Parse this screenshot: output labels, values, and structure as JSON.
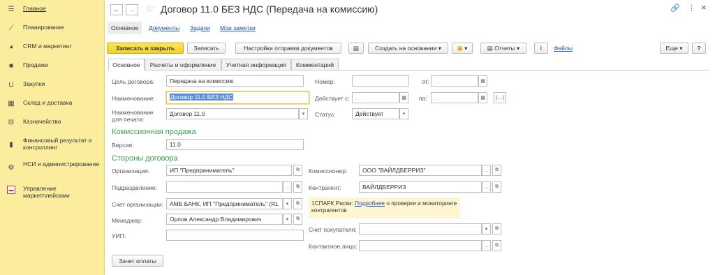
{
  "sidebar": {
    "items": [
      {
        "label": "Главное",
        "icon": "menu-icon"
      },
      {
        "label": "Планирование",
        "icon": "chart-icon"
      },
      {
        "label": "CRM и маркетинг",
        "icon": "pie-icon"
      },
      {
        "label": "Продажи",
        "icon": "bag-icon"
      },
      {
        "label": "Закупки",
        "icon": "cart-icon"
      },
      {
        "label": "Склад и доставка",
        "icon": "grid-icon"
      },
      {
        "label": "Казначейство",
        "icon": "coins-icon"
      },
      {
        "label": "Финансовый результат и контроллинг",
        "icon": "bars-icon"
      },
      {
        "label": "НСИ и администрирование",
        "icon": "gear-icon"
      },
      {
        "label": "Управление маркетплейсами",
        "icon": "marketplace-icon"
      }
    ]
  },
  "header": {
    "title": "Договор 11.0 БЕЗ НДС (Передача на комиссию)",
    "back": "←",
    "forward": "→",
    "star": "☆",
    "link_icon": "🔗",
    "more_icon": "⋮",
    "close_icon": "×"
  },
  "sections": {
    "main": "Основное",
    "documents": "Документы",
    "tasks": "Задачи",
    "notes": "Мои заметки"
  },
  "toolbar": {
    "save_close": "Записать и закрыть",
    "save": "Записать",
    "send_settings": "Настройки отправки документов",
    "create_based": "Создать на основании",
    "reports": "Отчеты",
    "files": "Файлы",
    "more": "Еще",
    "help": "?",
    "dropdown": "▾"
  },
  "tabs": [
    "Основное",
    "Расчеты и оформление",
    "Учетная информация",
    "Комментарий"
  ],
  "form": {
    "purpose_label": "Цель договора:",
    "purpose_value": "Передача на комиссию",
    "name_label": "Наименование:",
    "name_value": "Договор 11.0 БЕЗ НДС",
    "print_name_label_1": "Наименование",
    "print_name_label_2": "для печати:",
    "print_name_value": "Договор 11.0",
    "number_label": "Номер:",
    "number_value": "",
    "from_label": "от:",
    "from_value": " .  .",
    "valid_from_label": "Действует с:",
    "valid_from_value": " .  .",
    "to_label": "по:",
    "to_value": " .  .",
    "status_label": "Статус:",
    "status_value": "Действует",
    "commission_group": "Комиссионная продажа",
    "version_label": "Версия:",
    "version_value": "11.0",
    "parties_group": "Стороны договора",
    "org_label": "Организация:",
    "org_value": "ИП \"Предприниматель\"",
    "division_label": "Подразделение:",
    "division_value": "",
    "account_label": "Счет организации:",
    "account_value": "АМБ БАНК, ИП \"Предприниматель\" (RL",
    "manager_label": "Менеджер:",
    "manager_value": "Орлов Александр Владимирович",
    "uip_label": "УИП:",
    "uip_value": "",
    "commissioner_label": "Комиссионер:",
    "commissioner_value": "ООО \"ВАЙЛДБЕРРИЗ\"",
    "contractor_label": "Контрагент:",
    "contractor_value": "ВАЙЛДБЕРРИЗ",
    "spark_prefix": "1СПАРК Риски:",
    "spark_link": "Подробнее",
    "spark_suffix": "о проверке и мониторинге контрагентов",
    "buyer_account_label": "Счет покупателя:",
    "buyer_account_value": "",
    "contact_label": "Контактное лицо:",
    "contact_value": "",
    "pay_button": "Зачет оплаты"
  },
  "colors": {
    "sidebar_bg": "#fbed9e",
    "primary_button": "#f3cf2c",
    "group_title": "#3c9f54",
    "link": "#1c50b5"
  }
}
